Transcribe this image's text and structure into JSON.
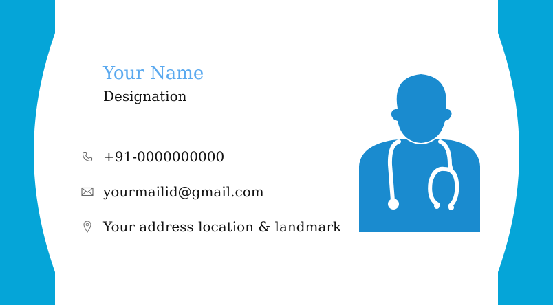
{
  "card": {
    "name": "Your Name",
    "designation": "Designation",
    "accent_color": "#05a5d8",
    "name_color": "#5aa9ef",
    "illustration_color": "#1a8bcf"
  },
  "contacts": [
    {
      "icon": "phone-icon",
      "text": "+91-0000000000"
    },
    {
      "icon": "mail-icon",
      "text": "yourmailid@gmail.com"
    },
    {
      "icon": "location-pin-icon",
      "text": "Your address location & landmark"
    }
  ],
  "illustration": {
    "icon": "doctor-with-stethoscope-icon"
  }
}
